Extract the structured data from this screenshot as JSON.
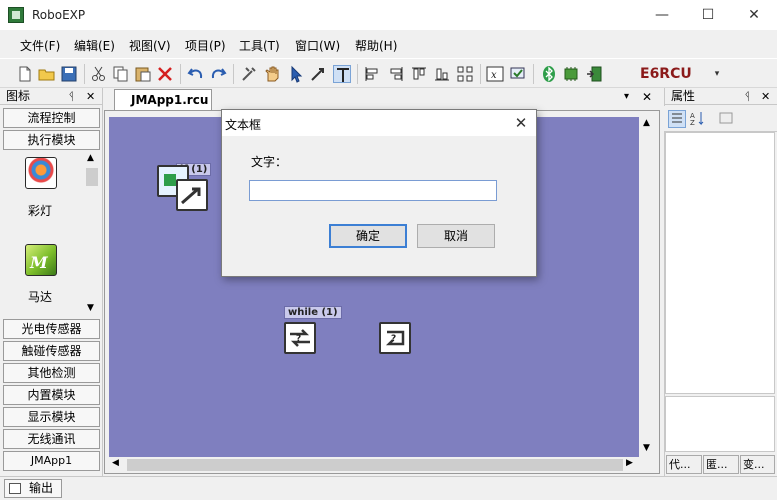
{
  "app": {
    "title": "RoboEXP"
  },
  "window_controls": {
    "minimize": "—",
    "maximize": "☐",
    "close": "✕"
  },
  "menu": [
    "文件(F)",
    "编辑(E)",
    "视图(V)",
    "项目(P)",
    "工具(T)",
    "窗口(W)",
    "帮助(H)"
  ],
  "toolbar": {
    "icons": [
      "new-file-icon",
      "open-folder-icon",
      "save-icon",
      "cut-icon",
      "copy-icon",
      "paste-icon",
      "delete-icon",
      "undo-icon",
      "redo-icon",
      "tools-icon",
      "hand-icon",
      "pointer-icon",
      "link-icon",
      "text-icon",
      "align-left-icon",
      "align-right-icon",
      "align-top-icon",
      "align-bottom-icon",
      "grid-icon",
      "variable-icon",
      "compile-icon",
      "bluetooth-icon",
      "chip-icon",
      "download-icon"
    ],
    "target": "E6RCU",
    "dropdown": "▾"
  },
  "left_panel": {
    "title": "图标",
    "pin": "ᛩ",
    "close": "✕",
    "top_categories": [
      "流程控制",
      "执行模块"
    ],
    "palette": [
      {
        "label": "彩灯",
        "icon": "color-lamp-icon"
      },
      {
        "label": "马达",
        "icon": "motor-icon"
      }
    ],
    "bottom_categories": [
      "光电传感器",
      "触碰传感器",
      "其他检测",
      "内置模块",
      "显示模块",
      "无线通讯",
      "JMApp1"
    ]
  },
  "document": {
    "tab": "JMApp1.rcu",
    "tab_menu": "▾",
    "tab_close": "✕"
  },
  "canvas_blocks": [
    {
      "label": "if (1)",
      "icon": "if-block-icon"
    },
    {
      "label": "while (1)",
      "icon": "while-block-icon"
    },
    {
      "label": "",
      "icon": "loop-end-block-icon"
    }
  ],
  "dialog": {
    "title": "文本框",
    "close": "✕",
    "field_label": "文字：",
    "field_value": "",
    "ok": "确定",
    "cancel": "取消"
  },
  "right_panel": {
    "title": "属性",
    "pin": "ᛩ",
    "close": "✕",
    "tabs": [
      "代...",
      "匿...",
      "变..."
    ]
  },
  "bottom": {
    "output_tab": "输出"
  },
  "colors": {
    "canvas": "#7f7fbf",
    "target": "#8b1a1a",
    "focus": "#3c7fd4"
  }
}
